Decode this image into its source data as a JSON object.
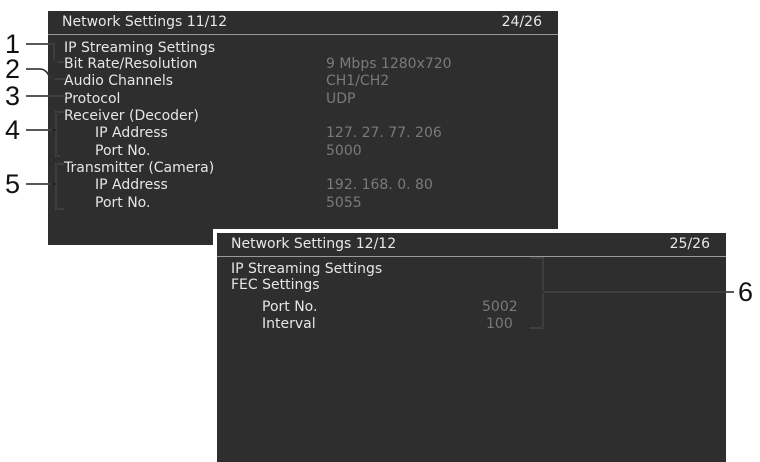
{
  "screen1": {
    "title": "Network Settings 11/12",
    "page": "24/26",
    "section": "IP Streaming Settings",
    "rows": [
      {
        "label": "Bit Rate/Resolution",
        "value": "9 Mbps 1280x720"
      },
      {
        "label": "Audio Channels",
        "value": "CH1/CH2"
      },
      {
        "label": "Protocol",
        "value": "UDP"
      },
      {
        "label": "Receiver (Decoder)",
        "value": ""
      },
      {
        "label": "IP Address",
        "value": "127. 27. 77. 206"
      },
      {
        "label": "Port No.",
        "value": "5000"
      },
      {
        "label": "Transmitter (Camera)",
        "value": ""
      },
      {
        "label": "IP Address",
        "value": "192. 168. 0. 80"
      },
      {
        "label": "Port No.",
        "value": "5055"
      }
    ]
  },
  "screen2": {
    "title": "Network Settings 12/12",
    "page": "25/26",
    "section": "IP Streaming Settings",
    "subsection": "FEC Settings",
    "rows": [
      {
        "label": "Port No.",
        "value": "5002"
      },
      {
        "label": "Interval",
        "value": "100"
      }
    ]
  },
  "callouts": [
    "1",
    "2",
    "3",
    "4",
    "5",
    "6"
  ]
}
